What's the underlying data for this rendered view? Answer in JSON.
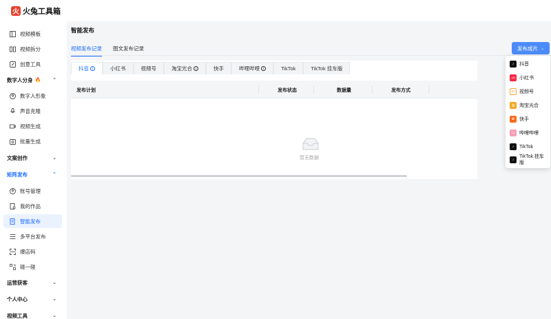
{
  "app": {
    "title": "火兔工具箱"
  },
  "sidebar": {
    "top_items": [
      {
        "label": "视频模板",
        "icon": "layout-icon"
      },
      {
        "label": "视频拆分",
        "icon": "split-icon"
      },
      {
        "label": "创意工具",
        "icon": "edit-icon"
      }
    ],
    "groups": [
      {
        "label": "数字人分身",
        "badge": "🔥",
        "expanded": true,
        "items": [
          {
            "label": "数字人形象",
            "icon": "avatar-icon"
          },
          {
            "label": "声音克隆",
            "icon": "mic-icon"
          },
          {
            "label": "视频生成",
            "icon": "video-icon"
          },
          {
            "label": "批量生成",
            "icon": "batch-icon"
          }
        ]
      },
      {
        "label": "文案创作",
        "expanded": false
      },
      {
        "label": "矩阵发布",
        "expanded": true,
        "items": [
          {
            "label": "账号管理",
            "icon": "user-icon"
          },
          {
            "label": "我的作品",
            "icon": "works-icon"
          },
          {
            "label": "智能发布",
            "icon": "publish-icon",
            "active": true
          },
          {
            "label": "多平台发布",
            "icon": "multi-icon"
          },
          {
            "label": "爆店码",
            "icon": "scan-icon"
          },
          {
            "label": "碰一碰",
            "icon": "nfc-icon"
          }
        ]
      },
      {
        "label": "运营获客",
        "expanded": false
      },
      {
        "label": "个人中心",
        "expanded": false
      },
      {
        "label": "视频工具",
        "expanded": false
      }
    ]
  },
  "main": {
    "title": "智能发布",
    "tabs": [
      {
        "label": "视频发布记录",
        "active": true
      },
      {
        "label": "图文发布记录",
        "active": false
      }
    ],
    "publish_button": "发布成片",
    "platform_tabs": [
      {
        "label": "抖音",
        "info": true,
        "active": true
      },
      {
        "label": "小红书"
      },
      {
        "label": "视频号"
      },
      {
        "label": "淘宝光合",
        "info": true
      },
      {
        "label": "快手"
      },
      {
        "label": "哔哩哔哩",
        "info": true
      },
      {
        "label": "TikTok"
      },
      {
        "label": "TikTok 挂车版"
      }
    ],
    "table": {
      "columns": [
        "发布计划",
        "发布状态",
        "数据量",
        "发布方式"
      ],
      "empty_text": "暂无数据"
    }
  },
  "dropdown": {
    "items": [
      {
        "label": "抖音",
        "color": "#111111"
      },
      {
        "label": "小红书",
        "color": "#ff2442"
      },
      {
        "label": "视频号",
        "color": "#f7a32b"
      },
      {
        "label": "淘宝光合",
        "color": "#f5a623"
      },
      {
        "label": "快手",
        "color": "#ff6a1a"
      },
      {
        "label": "哔哩哔哩",
        "color": "#f4a0b4"
      },
      {
        "label": "TikTok",
        "color": "#111111"
      },
      {
        "label": "TikTok 挂车版",
        "color": "#111111"
      }
    ]
  },
  "colors": {
    "accent": "#1a6dff",
    "button": "#4d8cf8"
  }
}
